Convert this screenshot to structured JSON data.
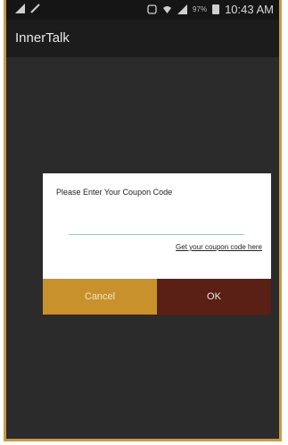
{
  "statusbar": {
    "percent": "97%",
    "time": "10:43 AM"
  },
  "app": {
    "title": "InnerTalk"
  },
  "dialog": {
    "title": "Please Enter Your Coupon Code",
    "input_value": "",
    "link": "Get your coupon code here",
    "cancel": "Cancel",
    "ok": "OK"
  },
  "colors": {
    "cancel_bg": "#c9912b",
    "ok_bg": "#5a2016",
    "frame": "#c89a4a"
  }
}
